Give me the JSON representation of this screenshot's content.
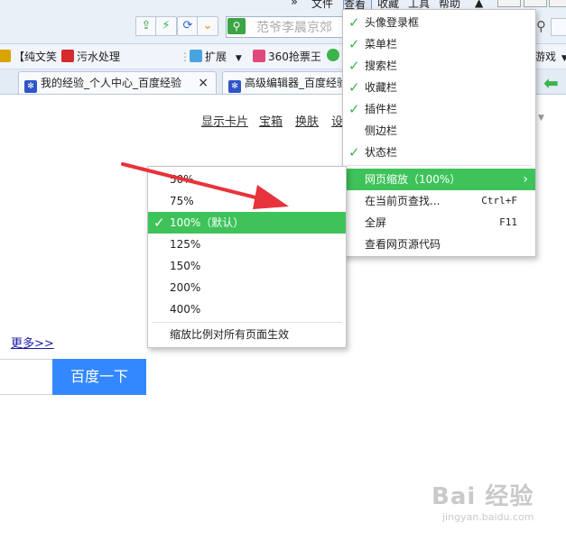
{
  "toolbar": {
    "chevrons": "»",
    "address_placeholder": "范爷李晨京郊"
  },
  "menubar": {
    "items": [
      "文件",
      "查看",
      "收藏",
      "工具",
      "帮助"
    ]
  },
  "bookmarks": [
    {
      "label": "【纯文笑",
      "icon_color": "#d9a300"
    },
    {
      "label": "污水处理",
      "icon_color": "#d62b2b"
    },
    {
      "label": "扩展",
      "icon_color": "#4aa3df"
    },
    {
      "label": "360抢票王",
      "icon_color": "#e04a7a"
    },
    {
      "label": "游戏",
      "icon_color": "#888888"
    }
  ],
  "tabs": [
    {
      "title": "我的经验_个人中心_百度经验",
      "close": "×"
    },
    {
      "title": "高级编辑器_百度经验",
      "close": ""
    }
  ],
  "page": {
    "links": [
      "显示卡片",
      "宝箱",
      "换肤",
      "设"
    ],
    "more_link": "更多>>",
    "search_button": "百度一下"
  },
  "view_menu": {
    "items": [
      {
        "label": "头像登录框",
        "checked": true
      },
      {
        "label": "菜单栏",
        "checked": true
      },
      {
        "label": "搜索栏",
        "checked": true
      },
      {
        "label": "收藏栏",
        "checked": true
      },
      {
        "label": "插件栏",
        "checked": true
      },
      {
        "label": "侧边栏",
        "checked": false
      },
      {
        "label": "状态栏",
        "checked": true
      },
      {
        "label": "网页缩放（100%）",
        "submenu_arrow": "›",
        "highlighted": true
      },
      {
        "label": "在当前页查找...",
        "shortcut": "Ctrl+F"
      },
      {
        "label": "全屏",
        "shortcut": "F11"
      },
      {
        "label": "查看网页源代码"
      }
    ]
  },
  "zoom_menu": {
    "items": [
      "50%",
      "75%",
      "100%（默认）",
      "125%",
      "150%",
      "200%",
      "400%"
    ],
    "selected_index": 2,
    "footer": "缩放比例对所有页面生效"
  },
  "watermark": {
    "logo": "Bai 经验",
    "url": "jingyan.baidu.com"
  },
  "colors": {
    "accent_green": "#3ec35a",
    "search_blue": "#3388ff",
    "arrow_red": "#e8323c"
  }
}
